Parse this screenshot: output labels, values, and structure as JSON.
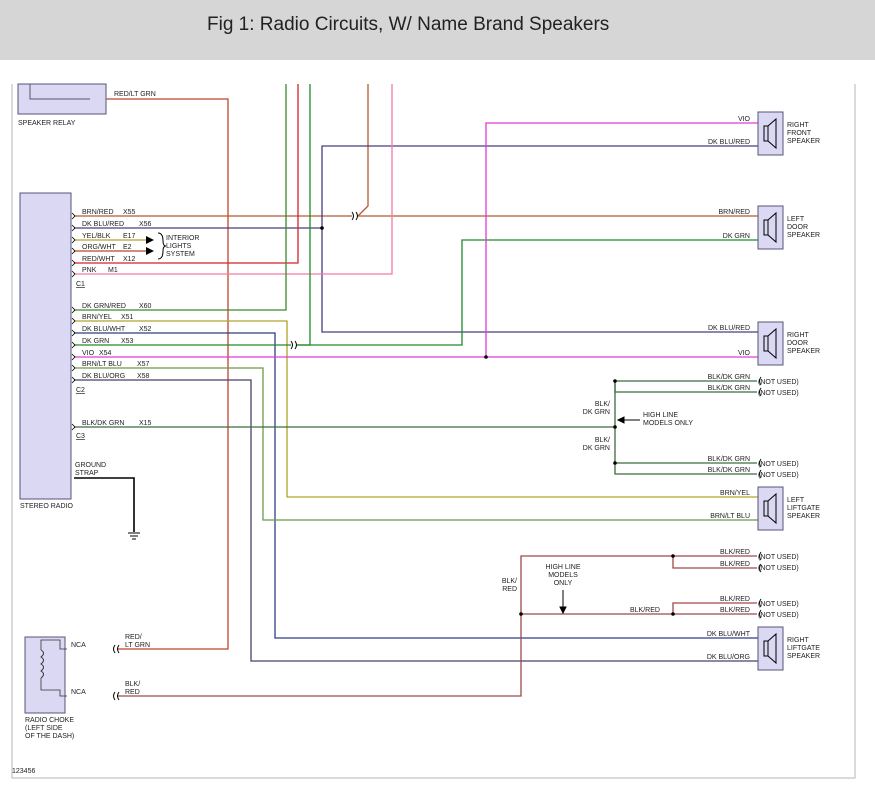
{
  "header": {
    "title": "Fig 1: Radio Circuits, W/ Name Brand Speakers"
  },
  "colors": {
    "red_lt_grn": "#c0452a",
    "brn_red": "#b5592e",
    "dk_blu_red": "#4a3d7c",
    "red_wht": "#d2232a",
    "pink": "#f47aa8",
    "dk_grn_red": "#3a8a2a",
    "brn_yel": "#b0a32a",
    "dk_blu_wht": "#2c3f86",
    "dk_grn": "#1e8a2a",
    "vio": "#e33ad6",
    "brn_lt_blu": "#6b9a4a",
    "dk_blu_org": "#4b3f6c",
    "blk_dk_grn": "#3c6c3c",
    "blk_red": "#a04848",
    "ground": "#000000",
    "component_fill": "#dad8f2",
    "component_stroke": "#555577"
  },
  "components": {
    "speaker_relay": "SPEAKER RELAY",
    "stereo_radio": "STEREO RADIO",
    "radio_choke": [
      "RADIO CHOKE",
      "(LEFT SIDE",
      "OF THE DASH)"
    ],
    "ground_strap": [
      "GROUND",
      "STRAP"
    ],
    "interior_lights": [
      "INTERIOR",
      "LIGHTS",
      "SYSTEM"
    ],
    "high_line_right": [
      "HIGH LINE",
      "MODELS ONLY"
    ],
    "high_line_lower": [
      "HIGH LINE",
      "MODELS",
      "ONLY"
    ]
  },
  "connectors": {
    "c1": "C1",
    "c2": "C2",
    "c3": "C3"
  },
  "radio_pins": [
    {
      "wire": "BRN/RED",
      "circuit": "X55"
    },
    {
      "wire": "DK BLU/RED",
      "circuit": "X56"
    },
    {
      "wire": "YEL/BLK",
      "circuit": "E17"
    },
    {
      "wire": "ORG/WHT",
      "circuit": "E2"
    },
    {
      "wire": "RED/WHT",
      "circuit": "X12"
    },
    {
      "wire": "PNK",
      "circuit": "M1"
    },
    {
      "wire": "DK GRN/RED",
      "circuit": "X60"
    },
    {
      "wire": "BRN/YEL",
      "circuit": "X51"
    },
    {
      "wire": "DK BLU/WHT",
      "circuit": "X52"
    },
    {
      "wire": "DK GRN",
      "circuit": "X53"
    },
    {
      "wire": "VIO",
      "circuit": "X54"
    },
    {
      "wire": "BRN/LT BLU",
      "circuit": "X57"
    },
    {
      "wire": "DK BLU/ORG",
      "circuit": "X58"
    },
    {
      "wire": "BLK/DK GRN",
      "circuit": "X15"
    }
  ],
  "relay_wire": "RED/LT GRN",
  "speakers": [
    {
      "name": [
        "RIGHT",
        "FRONT",
        "SPEAKER"
      ],
      "wires": [
        "VIO",
        "DK BLU/RED"
      ]
    },
    {
      "name": [
        "LEFT",
        "DOOR",
        "SPEAKER"
      ],
      "wires": [
        "BRN/RED",
        "DK GRN"
      ]
    },
    {
      "name": [
        "RIGHT",
        "DOOR",
        "SPEAKER"
      ],
      "wires": [
        "DK BLU/RED",
        "VIO"
      ]
    },
    {
      "name": [
        "LEFT",
        "LIFTGATE",
        "SPEAKER"
      ],
      "wires": [
        "BRN/YEL",
        "BRN/LT BLU"
      ]
    },
    {
      "name": [
        "RIGHT",
        "LIFTGATE",
        "SPEAKER"
      ],
      "wires": [
        "DK BLU/WHT",
        "DK BLU/ORG"
      ]
    }
  ],
  "blk_dk_grn_split": {
    "label": [
      "BLK/",
      "DK GRN"
    ],
    "branch_wire": "BLK/DK GRN",
    "note": "(NOT USED)"
  },
  "blk_red_split": {
    "label": [
      "BLK/",
      "RED"
    ],
    "branch_wire": "BLK/RED",
    "trunk_wire": "BLK/RED",
    "note": "(NOT USED)"
  },
  "choke": {
    "pin": "NCA",
    "top_wire": [
      "RED/",
      "LT GRN"
    ],
    "bottom_wire": [
      "BLK/",
      "RED"
    ]
  },
  "diagram_id": "123456"
}
